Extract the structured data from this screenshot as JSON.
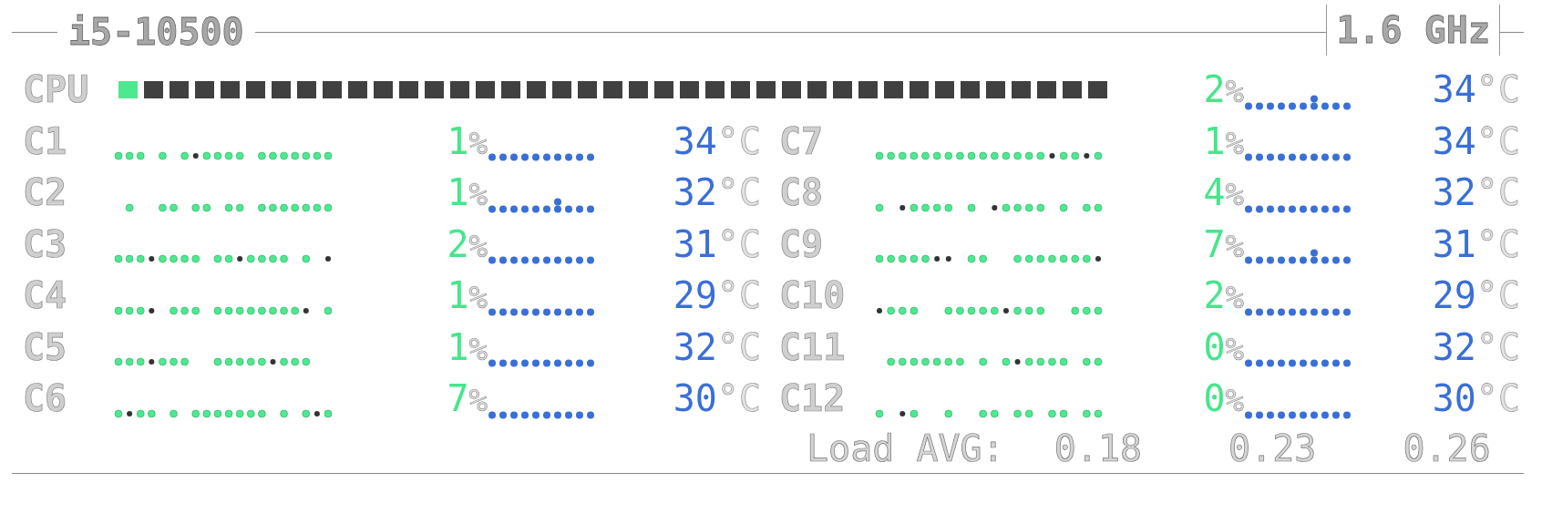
{
  "header": {
    "title": "i5-10500",
    "frequency": "1.6 GHz"
  },
  "cpu": {
    "label": "CPU",
    "level": 0.02,
    "usage": "2",
    "usage_unit": "%",
    "temp": "34",
    "temp_unit": "°C"
  },
  "cores": [
    {
      "label": "C1",
      "usage": "1",
      "usage_unit": "%",
      "temp": "34",
      "temp_unit": "°C"
    },
    {
      "label": "C2",
      "usage": "1",
      "usage_unit": "%",
      "temp": "32",
      "temp_unit": "°C"
    },
    {
      "label": "C3",
      "usage": "2",
      "usage_unit": "%",
      "temp": "31",
      "temp_unit": "°C"
    },
    {
      "label": "C4",
      "usage": "1",
      "usage_unit": "%",
      "temp": "29",
      "temp_unit": "°C"
    },
    {
      "label": "C5",
      "usage": "1",
      "usage_unit": "%",
      "temp": "32",
      "temp_unit": "°C"
    },
    {
      "label": "C6",
      "usage": "7",
      "usage_unit": "%",
      "temp": "30",
      "temp_unit": "°C"
    },
    {
      "label": "C7",
      "usage": "1",
      "usage_unit": "%",
      "temp": "34",
      "temp_unit": "°C"
    },
    {
      "label": "C8",
      "usage": "4",
      "usage_unit": "%",
      "temp": "32",
      "temp_unit": "°C"
    },
    {
      "label": "C9",
      "usage": "7",
      "usage_unit": "%",
      "temp": "31",
      "temp_unit": "°C"
    },
    {
      "label": "C10",
      "usage": "2",
      "usage_unit": "%",
      "temp": "29",
      "temp_unit": "°C"
    },
    {
      "label": "C11",
      "usage": "0",
      "usage_unit": "%",
      "temp": "32",
      "temp_unit": "°C"
    },
    {
      "label": "C12",
      "usage": "0",
      "usage_unit": "%",
      "temp": "30",
      "temp_unit": "°C"
    }
  ],
  "load_avg": {
    "label": "Load AVG:",
    "values": [
      "0.18",
      "0.23",
      "0.26"
    ]
  }
}
